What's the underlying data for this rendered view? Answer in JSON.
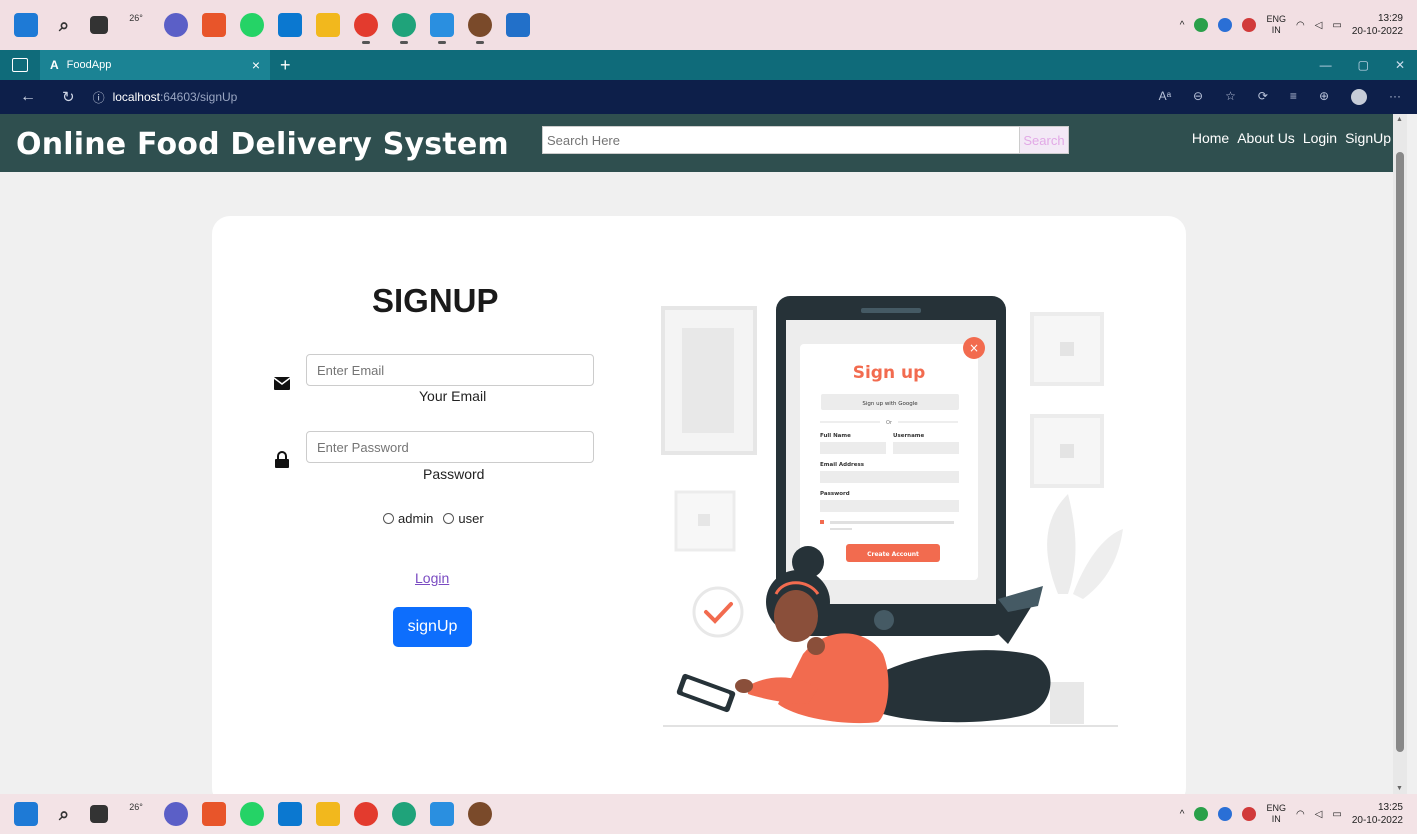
{
  "taskbar_top": {
    "weather_temp": "26°",
    "lang_line1": "ENG",
    "lang_line2": "IN",
    "time": "13:29",
    "date": "20-10-2022"
  },
  "taskbar_bottom": {
    "weather_temp": "26°",
    "lang_line1": "ENG",
    "lang_line2": "IN",
    "time": "13:25",
    "date": "20-10-2022"
  },
  "browser": {
    "tab_logo": "A",
    "tab_title": "FoodApp",
    "url_host": "localhost",
    "url_path": ":64603/signUp"
  },
  "navbar": {
    "brand": "Online Food Delivery System",
    "search_placeholder": "Search Here",
    "search_button": "Search",
    "links": [
      "Home",
      "About Us",
      "Login",
      "SignUp"
    ]
  },
  "form": {
    "title": "SIGNUP",
    "email_placeholder": "Enter Email",
    "email_label": "Your Email",
    "password_placeholder": "Enter Password",
    "password_label": "Password",
    "role_admin": "admin",
    "role_user": "user",
    "login_link": "Login",
    "signup_button": "signUp"
  },
  "illustration": {
    "title": "Sign up",
    "google_button": "Sign up with Google",
    "or_text": "Or",
    "full_name_label": "Full Name",
    "username_label": "Username",
    "email_label": "Email Address",
    "password_label": "Password",
    "create_button": "Create Account"
  },
  "colors": {
    "navbar_bg": "#2f4f4f",
    "primary_button": "#0d6efd",
    "illustration_accent": "#f26b4f"
  }
}
